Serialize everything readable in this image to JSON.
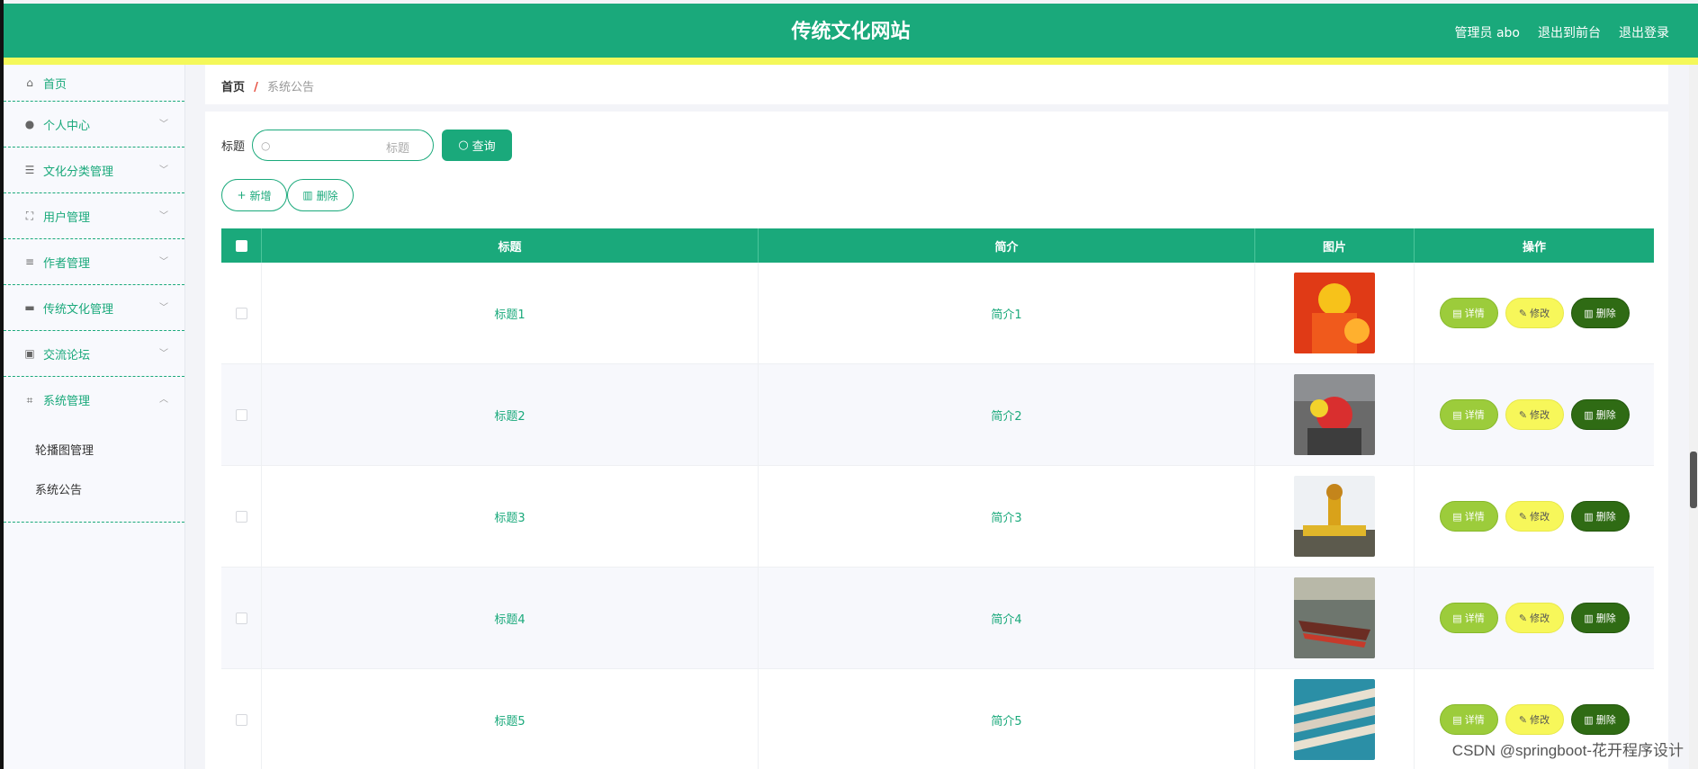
{
  "header": {
    "site_title": "传统文化网站",
    "admin": "管理员 abo",
    "back_front": "退出到前台",
    "logout": "退出登录",
    "colors": {
      "primary": "#1aa97b",
      "stripe": "#f4f85a"
    }
  },
  "sidebar": {
    "items": [
      {
        "label": "首页",
        "icon": "home-icon"
      },
      {
        "label": "个人中心",
        "icon": "user-icon"
      },
      {
        "label": "文化分类管理",
        "icon": "list-icon"
      },
      {
        "label": "用户管理",
        "icon": "frame-icon"
      },
      {
        "label": "作者管理",
        "icon": "sliders-icon"
      },
      {
        "label": "传统文化管理",
        "icon": "monitor-icon"
      },
      {
        "label": "交流论坛",
        "icon": "clipboard-icon"
      },
      {
        "label": "系统管理",
        "icon": "crop-icon"
      }
    ],
    "sub_items": [
      "轮播图管理",
      "系统公告"
    ]
  },
  "breadcrumb": {
    "home": "首页",
    "separator": "/",
    "current": "系统公告"
  },
  "search": {
    "label": "标题",
    "placeholder": "标题",
    "query_button": "查询"
  },
  "actions": {
    "add": "新增",
    "delete": "删除"
  },
  "table": {
    "headers": [
      "标题",
      "简介",
      "图片",
      "操作"
    ],
    "rows": [
      {
        "title": "标题1",
        "intro": "简介1"
      },
      {
        "title": "标题2",
        "intro": "简介2"
      },
      {
        "title": "标题3",
        "intro": "简介3"
      },
      {
        "title": "标题4",
        "intro": "简介4"
      },
      {
        "title": "标题5",
        "intro": "简介5"
      }
    ],
    "op_buttons": {
      "detail": "详情",
      "edit": "修改",
      "delete": "删除"
    }
  },
  "watermark": "CSDN @springboot-花开程序设计"
}
